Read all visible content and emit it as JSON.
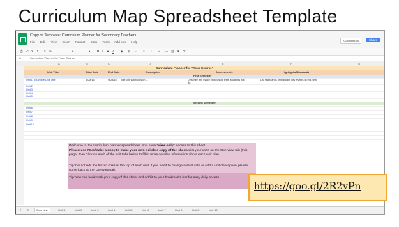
{
  "slide": {
    "title": "Curriculum Map Spreadsheet Template",
    "url": "https://goo.gl/2R2vPn"
  },
  "window": {
    "doc_title": "Copy of Template: Curriculum Planner for Secondary Teachers",
    "menus": [
      "File",
      "Edit",
      "View",
      "Insert",
      "Format",
      "Data",
      "Tools",
      "Add-ons",
      "Help"
    ],
    "comments_label": "Comments",
    "share_label": "Share",
    "formula_value": "Curriculum Planner for 'Your Course'"
  },
  "sheet": {
    "columns": [
      "A",
      "B",
      "C",
      "D",
      "E",
      "F",
      "G"
    ],
    "banner_title": "Curriculum Planner for \"Your Course\"",
    "headers": [
      "Unit Title",
      "Start Date",
      "End Date",
      "Description",
      "Assessments",
      "Highlights/Standards"
    ],
    "first_semester_label": "First Semester",
    "second_semester_label": "Second Semester",
    "unit1": {
      "title": "Unit 1: Example Unit Title",
      "start": "8/28/16",
      "end": "9/23/16",
      "description": "The unit will focus on...",
      "assessments": "Describe the major projects or tests students will do.",
      "highlights": "List standards or highlight key events in this unit."
    },
    "units_first": [
      "Unit 2",
      "Unit 3",
      "Unit 4",
      "Unit 5"
    ],
    "units_second": [
      "Unit 6",
      "Unit 7",
      "Unit 8",
      "Unit 9",
      "Unit 10"
    ]
  },
  "notes": {
    "p1_a": "Welcome to the curriculum planner spreadsheet. You have ",
    "p1_b": "\"view only\"",
    "p1_c": " access to this sheet.",
    "p2_a": "Please use FILE/Make a copy to make your own editable copy of the sheet.",
    "p2_b": " List your units on the Overview tab (this page) then click on each of the unit tabs below to fill in more detailed information about each unit plan.",
    "p3": "Tip: Do not edit the frozen rows at the top of each unit. If you need to change a start date or add a unit description please come back to the Overview tab.",
    "p4": "Tip: You can bookmark your copy of this sheet and add it to your bookmarks bar for easy daily access."
  },
  "tabs": [
    "Overview",
    "Unit 1",
    "Unit 2",
    "Unit 3",
    "Unit 4",
    "Unit 5",
    "Unit 6",
    "Unit 7",
    "Unit 8",
    "Unit 9",
    "Unit 10"
  ],
  "colors": {
    "sheets_green": "#0f9d58",
    "banner": "#fbe4b8",
    "header_row": "#f6d3b0",
    "semester": "#dcecd2",
    "note": "#e7c6d8",
    "url_fill": "#fde8b1",
    "url_border": "#f0a830"
  }
}
